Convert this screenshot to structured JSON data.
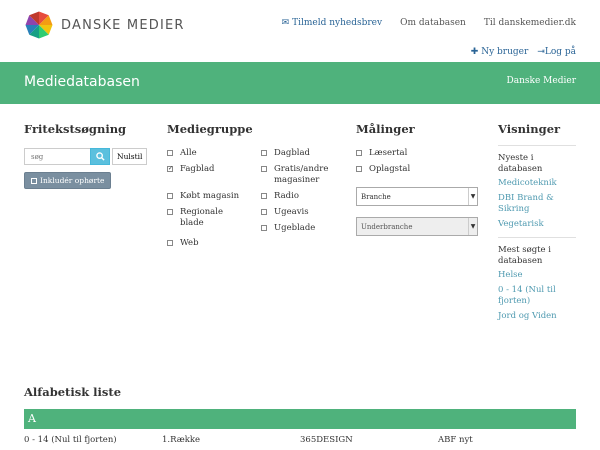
{
  "brand": {
    "name": "DANSKE MEDIER"
  },
  "toplinks": {
    "subscribe": "Tilmeld nyhedsbrev",
    "about": "Om databasen",
    "to_site": "Til danskemedier.dk"
  },
  "userlinks": {
    "new_user": "Ny bruger",
    "login": "Log på"
  },
  "band": {
    "title": "Mediedatabasen",
    "right": "Danske Medier"
  },
  "freetext": {
    "title": "Fritekstsøgning",
    "placeholder": "søg",
    "reset": "Nulstil",
    "include_closed": "Inkludér ophørte"
  },
  "mediagroup": {
    "title": "Mediegruppe",
    "items": [
      {
        "label": "Alle",
        "checked": false
      },
      {
        "label": "Dagblad",
        "checked": false
      },
      {
        "label": "Fagblad",
        "checked": true
      },
      {
        "label": "Gratis/andre magasiner",
        "checked": false
      },
      {
        "label": "Købt magasin",
        "checked": false
      },
      {
        "label": "Radio",
        "checked": false
      },
      {
        "label": "Regionale blade",
        "checked": false
      },
      {
        "label": "Ugeavis",
        "checked": false
      },
      {
        "label": "Web",
        "checked": false
      },
      {
        "label": "Ugeblade",
        "checked": false
      }
    ]
  },
  "measurements": {
    "title": "Målinger",
    "items": [
      {
        "label": "Læsertal"
      },
      {
        "label": "Oplagstal"
      }
    ],
    "branch": "Branche",
    "subbranch": "Underbranche"
  },
  "views": {
    "title": "Visninger",
    "newest_title": "Nyeste i databasen",
    "newest": [
      "Medicoteknik",
      "DBI Brand & Sikring",
      "Vegetarisk"
    ],
    "most_title": "Mest søgte i databasen",
    "most": [
      "Helse",
      "0 - 14 (Nul til fjorten)",
      "Jord og Viden"
    ]
  },
  "alphabet": {
    "title": "Alfabetisk liste",
    "letter": "A",
    "items": [
      "0 - 14 (Nul til fjorten)",
      "1.Række",
      "365DESIGN",
      "ABF nyt"
    ]
  },
  "colors": {
    "accent_green": "#4fb27c",
    "link": "#4f9ab0",
    "search_button": "#5bc0de"
  }
}
